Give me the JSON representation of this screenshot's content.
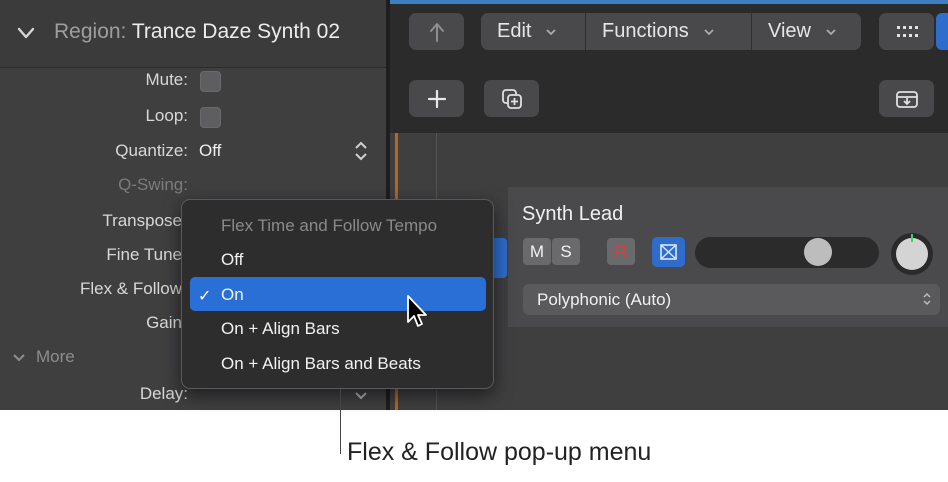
{
  "inspector": {
    "header": {
      "prefix": "Region:",
      "name": "Trance Daze Synth 02"
    },
    "rows": {
      "mute": "Mute:",
      "loop": "Loop:",
      "quantize": "Quantize:",
      "quantize_value": "Off",
      "qswing": "Q-Swing:",
      "transpose": "Transpose",
      "fine_tune": "Fine Tune",
      "flex_follow": "Flex & Follow",
      "gain": "Gain",
      "delay": "Delay:"
    },
    "more_label": "More"
  },
  "toolbar": {
    "edit": "Edit",
    "functions": "Functions",
    "view": "View"
  },
  "track": {
    "name": "Synth Lead",
    "mute": "M",
    "solo": "S",
    "record": "R",
    "volume_level": 0.7,
    "instrument_mode": "Polyphonic (Auto)"
  },
  "popup_menu": {
    "header": "Flex Time and Follow Tempo",
    "items": [
      "Off",
      "On",
      "On + Align Bars",
      "On + Align Bars and Beats"
    ],
    "selected": "On"
  },
  "callout": "Flex & Follow pop-up menu",
  "colors": {
    "accent": "#2a6fd6",
    "record": "#e23a3a"
  }
}
